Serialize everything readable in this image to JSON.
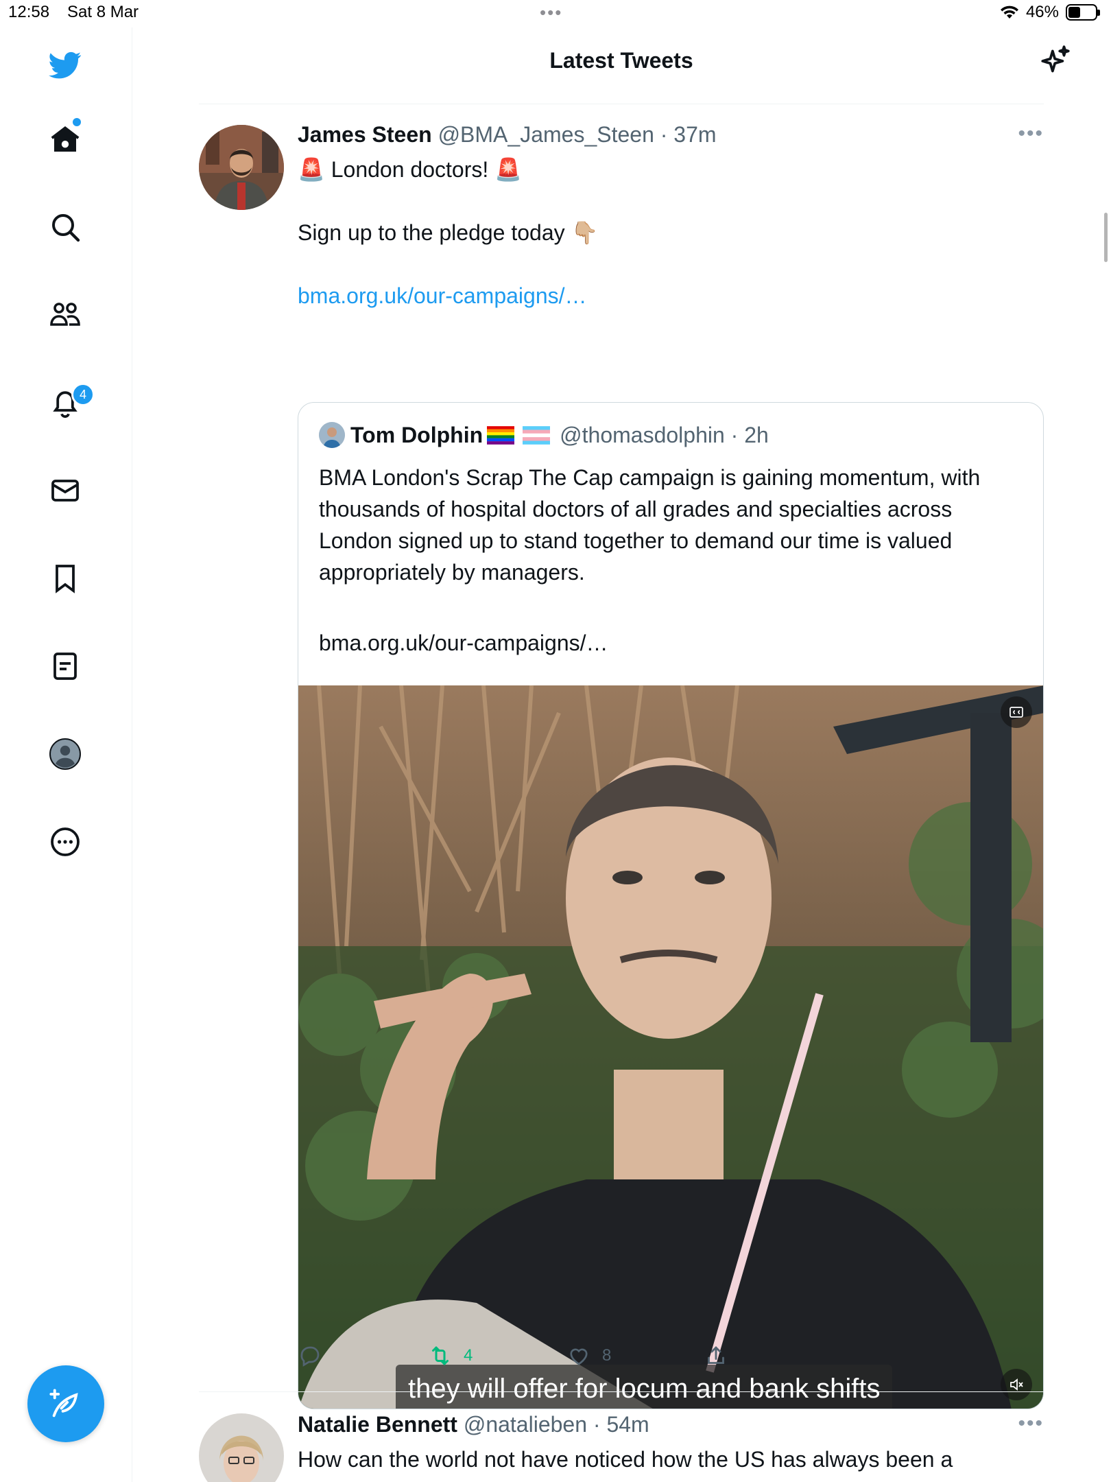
{
  "status_bar": {
    "time": "12:58",
    "date": "Sat 8 Mar",
    "battery": "46%"
  },
  "sidebar": {
    "items": [
      {
        "name": "home",
        "icon": "home-icon",
        "has_dot": true
      },
      {
        "name": "search",
        "icon": "search-icon"
      },
      {
        "name": "communities",
        "icon": "communities-icon"
      },
      {
        "name": "notifications",
        "icon": "bell-icon",
        "badge": "4"
      },
      {
        "name": "messages",
        "icon": "envelope-icon"
      },
      {
        "name": "bookmarks",
        "icon": "bookmark-icon"
      },
      {
        "name": "lists",
        "icon": "list-icon"
      },
      {
        "name": "profile",
        "icon": "profile-avatar-icon"
      },
      {
        "name": "more",
        "icon": "more-circle-icon"
      }
    ],
    "compose_icon": "compose-feather-icon"
  },
  "header": {
    "title": "Latest Tweets",
    "icon": "sparkle-icon"
  },
  "tweets": [
    {
      "name": "James Steen",
      "handle": "@BMA_James_Steen",
      "time": "37m",
      "line1": "London doctors!",
      "line2": "Sign up to the pledge today",
      "link": "bma.org.uk/our-campaigns/…",
      "quote": {
        "name": "Tom Dolphin",
        "handle": "@thomasdolphin",
        "time": "2h",
        "text": "BMA London's Scrap The Cap campaign is gaining momentum, with thousands of hospital doctors of all grades and specialties across London signed up to stand together to demand our time is valued appropriately by managers.",
        "link": "bma.org.uk/our-campaigns/…",
        "video_caption": "they will offer for locum and bank shifts"
      },
      "actions": {
        "reply": "",
        "retweet": "4",
        "like": "8",
        "share": ""
      }
    },
    {
      "name": "Natalie Bennett",
      "handle": "@natalieben",
      "time": "54m",
      "text": "How can the world not have noticed how the US has always been a"
    }
  ],
  "colors": {
    "accent": "#1d9bf0",
    "retweet_green": "#00ba7c",
    "secondary_text": "#536471"
  }
}
